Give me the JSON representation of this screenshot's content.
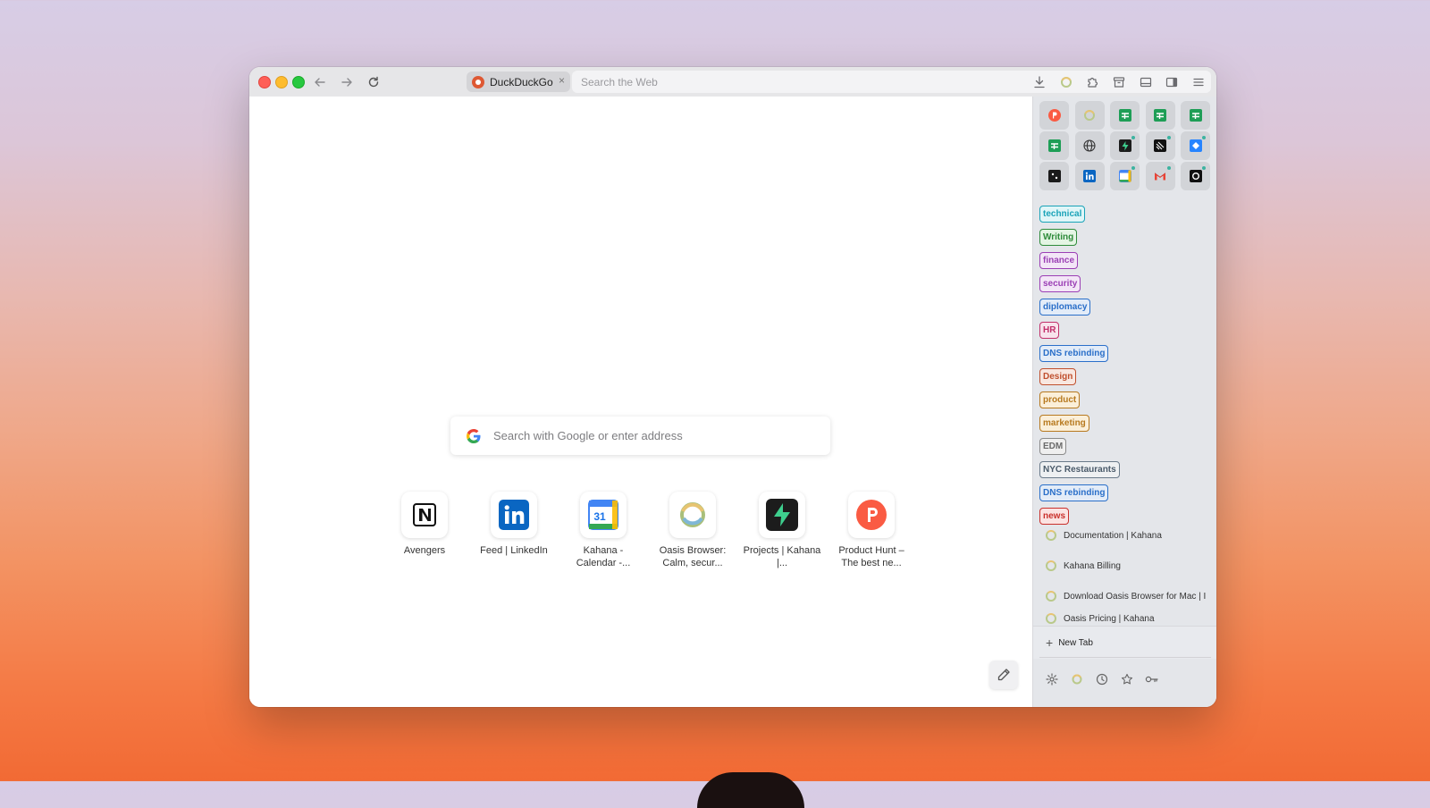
{
  "toolbar": {
    "tab_title": "DuckDuckGo",
    "tab_close": "×",
    "url_placeholder": "Search the Web"
  },
  "newtab_page": {
    "search_placeholder": "Search with Google or enter address",
    "shortcuts": [
      {
        "label": "Avengers",
        "icon": "notion-icon"
      },
      {
        "label": "Feed | LinkedIn",
        "icon": "linkedin-icon"
      },
      {
        "label": "Kahana - Calendar -...",
        "icon": "google-calendar-icon"
      },
      {
        "label": "Oasis Browser: Calm, secur...",
        "icon": "oasis-icon"
      },
      {
        "label": "Projects | Kahana |...",
        "icon": "supabase-icon"
      },
      {
        "label": "Product Hunt – The best ne...",
        "icon": "product-hunt-icon"
      }
    ]
  },
  "sidebar": {
    "tags": [
      {
        "label": "technical",
        "color": "#1aa3b8",
        "bg": "#e0f6f8"
      },
      {
        "label": "Writing",
        "color": "#2e8b3a",
        "bg": "#e4f5e4"
      },
      {
        "label": "finance",
        "color": "#9b3fb5",
        "bg": "#f3e6f7"
      },
      {
        "label": "security",
        "color": "#9b3fb5",
        "bg": "#f3e6f7"
      },
      {
        "label": "diplomacy",
        "color": "#2a6fc9",
        "bg": "#e3ecf8"
      },
      {
        "label": "HR",
        "color": "#c2306b",
        "bg": "#f8e3ec"
      },
      {
        "label": "DNS rebinding",
        "color": "#2a6fc9",
        "bg": "#e3ecf8"
      },
      {
        "label": "Design",
        "color": "#c0502e",
        "bg": "#f8e7e0"
      },
      {
        "label": "product",
        "color": "#b7791f",
        "bg": "#fbefd9"
      },
      {
        "label": "marketing",
        "color": "#b7791f",
        "bg": "#fbefd9"
      },
      {
        "label": "EDM",
        "color": "#6b6b6b",
        "bg": "#efefef"
      },
      {
        "label": "NYC Restaurants",
        "color": "#4a5a6a",
        "bg": "#eef0f2"
      },
      {
        "label": "DNS rebinding",
        "color": "#2a6fc9",
        "bg": "#e3ecf8"
      },
      {
        "label": "news",
        "color": "#c9302c",
        "bg": "#fbe3e2"
      }
    ],
    "tabs": [
      "Documentation | Kahana",
      "Kahana Billing",
      "Download Oasis Browser for Mac | Ir",
      "Oasis Pricing | Kahana"
    ],
    "new_tab_label": "New Tab",
    "new_tab_plus": "+"
  }
}
